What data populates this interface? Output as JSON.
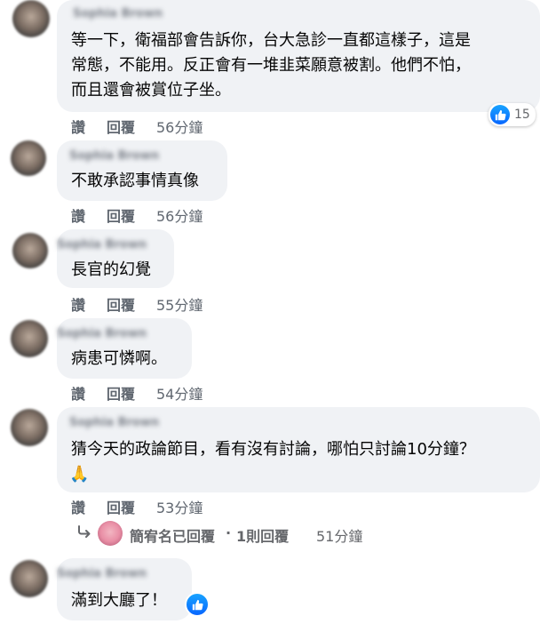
{
  "comments": [
    {
      "author": "Sophia Brown",
      "text_lines": [
        "等一下，衛福部會告訴你，台大急診一直都這樣子，這是",
        "常態，不能用。反正會有一堆韭菜願意被割。他們不怕，",
        "而且還會被賞位子坐。"
      ],
      "like_label": "讚",
      "reply_label": "回覆",
      "time": "56分鐘",
      "reaction_count": "15"
    },
    {
      "author": "Sophia Brown",
      "text_lines": [
        "不敢承認事情真像"
      ],
      "like_label": "讚",
      "reply_label": "回覆",
      "time": "56分鐘"
    },
    {
      "author": "Sophia Brown",
      "text_lines": [
        "長官的幻覺"
      ],
      "like_label": "讚",
      "reply_label": "回覆",
      "time": "55分鐘"
    },
    {
      "author": "Sophia Brown",
      "text_lines": [
        "病患可憐啊。"
      ],
      "like_label": "讚",
      "reply_label": "回覆",
      "time": "54分鐘"
    },
    {
      "author": "Sophia Brown",
      "text_lines": [
        "猜今天的政論節目，看有沒有討論，哪怕只討論10分鐘？",
        "🙏"
      ],
      "like_label": "讚",
      "reply_label": "回覆",
      "time": "53分鐘",
      "replies": {
        "name": "簡宥名已回覆",
        "dot": "·",
        "count": "1則回覆",
        "time": "51分鐘"
      }
    },
    {
      "author": "Sophia Brown",
      "text_lines": [
        "滿到大廳了！"
      ]
    }
  ],
  "colors": {
    "bubble": "#f0f2f5",
    "like_blue": "#0866ff",
    "meta": "#606770"
  },
  "icons": {
    "like": "thumbs-up-icon",
    "reply_arrow": "reply-arrow-icon"
  }
}
